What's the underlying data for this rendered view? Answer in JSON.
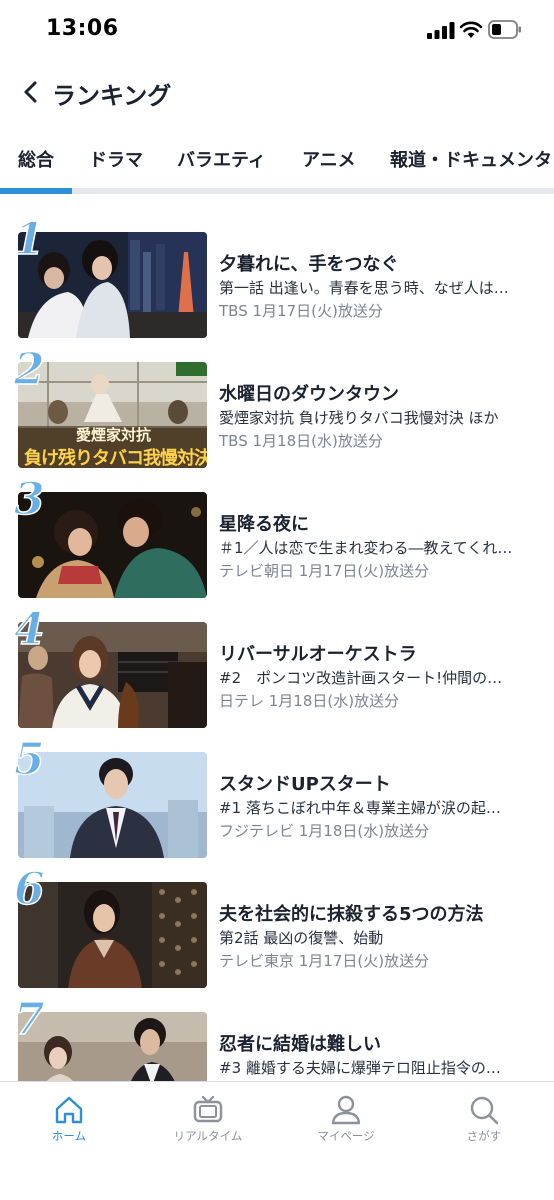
{
  "status_bar": {
    "time": "13:06",
    "icons": [
      "signal-icon",
      "wifi-icon",
      "battery-icon"
    ]
  },
  "header": {
    "back_icon": "chevron-left-icon",
    "title": "ランキング"
  },
  "tabs": [
    {
      "label": "総合",
      "active": true
    },
    {
      "label": "ドラマ",
      "active": false
    },
    {
      "label": "バラエティ",
      "active": false
    },
    {
      "label": "アニメ",
      "active": false
    },
    {
      "label": "報道・ドキュメンタリ",
      "active": false
    }
  ],
  "ranking": [
    {
      "rank": "1",
      "title": "夕暮れに、手をつなぐ",
      "subtitle": "第一話 出逢い。青春を思う時、なぜ人は…",
      "meta": "TBS 1月17日(火)放送分"
    },
    {
      "rank": "2",
      "title": "水曜日のダウンタウン",
      "subtitle": "愛煙家対抗 負け残りタバコ我慢対決 ほか",
      "meta": "TBS 1月18日(水)放送分",
      "thumb_caption_1": "愛煙家対抗",
      "thumb_caption_2": "負け残りタバコ我慢対決"
    },
    {
      "rank": "3",
      "title": "星降る夜に",
      "subtitle": "＃1／人は恋で生まれ変わる―教えてくれ…",
      "meta": "テレビ朝日 1月17日(火)放送分"
    },
    {
      "rank": "4",
      "title": "リバーサルオーケストラ",
      "subtitle": "#2　ポンコツ改造計画スタート!仲間の…",
      "meta": "日テレ 1月18日(水)放送分"
    },
    {
      "rank": "5",
      "title": "スタンドUPスタート",
      "subtitle": "#1 落ちこぼれ中年＆専業主婦が涙の起…",
      "meta": "フジテレビ 1月18日(水)放送分"
    },
    {
      "rank": "6",
      "title": "夫を社会的に抹殺する5つの方法",
      "subtitle": "第2話 最凶の復讐、始動",
      "meta": "テレビ東京 1月17日(火)放送分"
    },
    {
      "rank": "7",
      "title": "忍者に結婚は難しい",
      "subtitle": "#3 離婚する夫婦に爆弾テロ阻止指令の…",
      "meta": ""
    }
  ],
  "bottom_nav": [
    {
      "label": "ホーム",
      "icon": "home-icon",
      "active": true
    },
    {
      "label": "リアルタイム",
      "icon": "tv-icon",
      "active": false
    },
    {
      "label": "マイページ",
      "icon": "person-icon",
      "active": false
    },
    {
      "label": "さがす",
      "icon": "search-icon",
      "active": false
    }
  ],
  "colors": {
    "accent": "#2d8fd6",
    "rank_number": "#6aaee6",
    "meta_text": "#7e8592"
  }
}
